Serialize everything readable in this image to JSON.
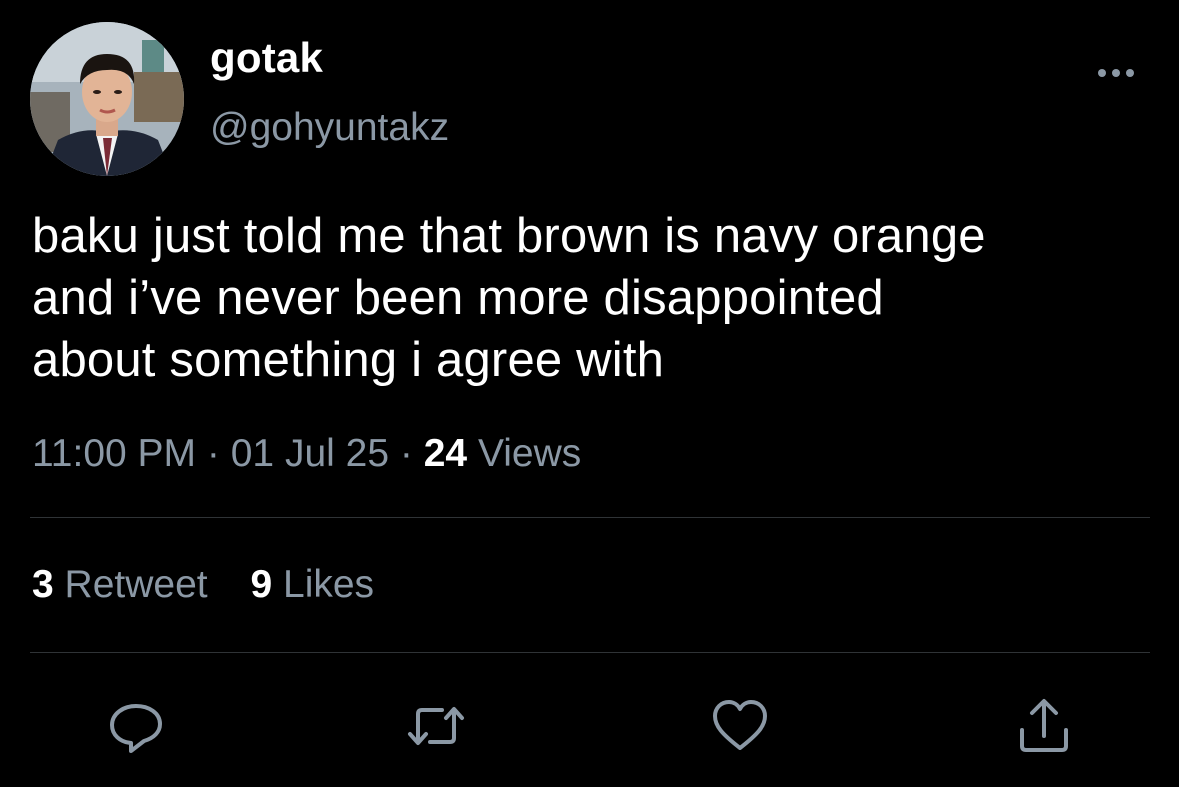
{
  "author": {
    "display_name": "gotak",
    "handle": "@gohyuntakz",
    "avatar_icon": "profile-photo"
  },
  "tweet": {
    "text": "baku just told me that brown is navy orange\nand i’ve never been more disappointed\nabout something i agree with"
  },
  "meta": {
    "time": "11:00 PM",
    "separator": "·",
    "date": "01 Jul 25",
    "views_count": "24",
    "views_label": "Views"
  },
  "stats": {
    "retweets_count": "3",
    "retweets_label": "Retweet",
    "likes_count": "9",
    "likes_label": "Likes"
  },
  "actions": [
    {
      "name": "reply",
      "icon": "speech-bubble-icon"
    },
    {
      "name": "retweet",
      "icon": "retweet-arrows-icon"
    },
    {
      "name": "like",
      "icon": "heart-icon"
    },
    {
      "name": "share",
      "icon": "share-upload-icon"
    }
  ],
  "colors": {
    "background": "#000000",
    "primary_text": "#ffffff",
    "secondary_text": "#8b98a5",
    "divider": "#2f3336"
  }
}
